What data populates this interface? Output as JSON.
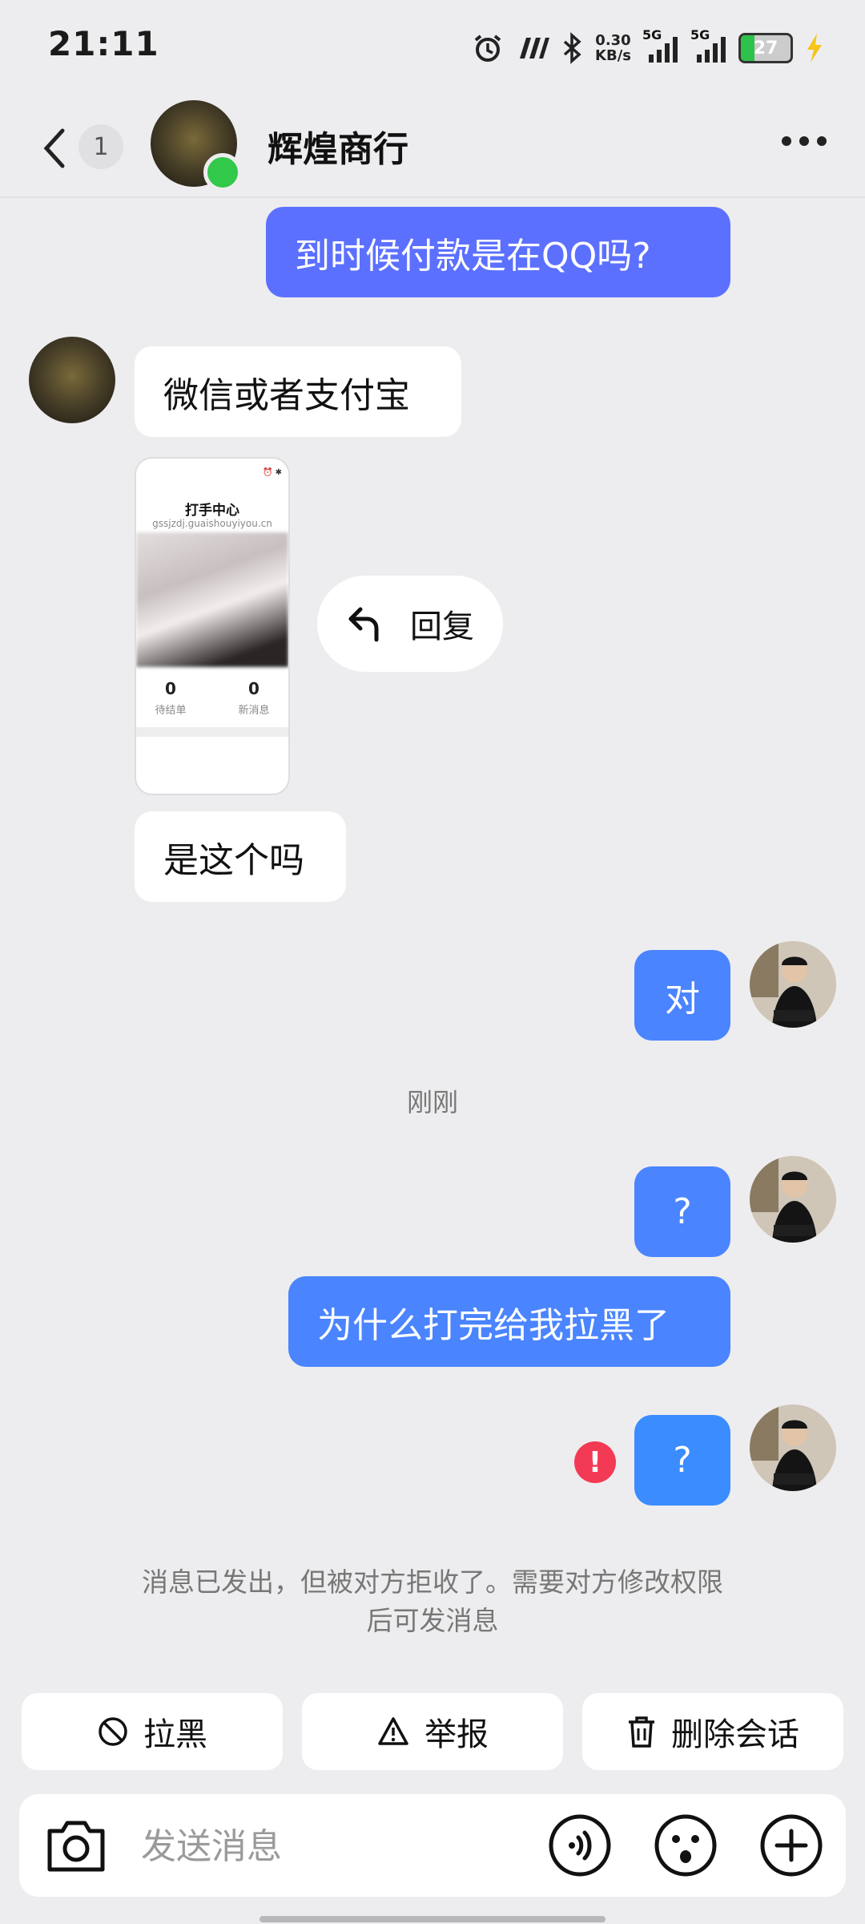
{
  "status_bar": {
    "time": "21:11",
    "net_speed_value": "0.30",
    "net_speed_unit": "KB/s",
    "sim1": "5G",
    "sim2": "5G",
    "battery": "27"
  },
  "header": {
    "unread_count": "1",
    "contact_name": "辉煌商行"
  },
  "messages": [
    {
      "dir": "out",
      "text": "到时候付款是在QQ吗?"
    },
    {
      "dir": "in",
      "text": "微信或者支付宝"
    },
    {
      "dir": "in",
      "type": "image",
      "image_title": "打手中心",
      "image_url": "gssjzdj.guaishouyiyou.cn",
      "stat1_num": "0",
      "stat1_label": "待结单",
      "stat2_num": "0",
      "stat2_label": "新消息"
    },
    {
      "dir": "in",
      "text": "是这个吗"
    },
    {
      "dir": "out",
      "text": "对"
    },
    {
      "dir": "out",
      "text": "?"
    },
    {
      "dir": "out",
      "text": "为什么打完给我拉黑了"
    },
    {
      "dir": "out",
      "text": "?",
      "failed": true
    }
  ],
  "reply_action": "回复",
  "time_separator": "刚刚",
  "block_notice": "消息已发出，但被对方拒收了。需要对方修改权限后可发消息",
  "actions": {
    "block": "拉黑",
    "report": "举报",
    "delete": "删除会话"
  },
  "input": {
    "placeholder": "发送消息"
  }
}
